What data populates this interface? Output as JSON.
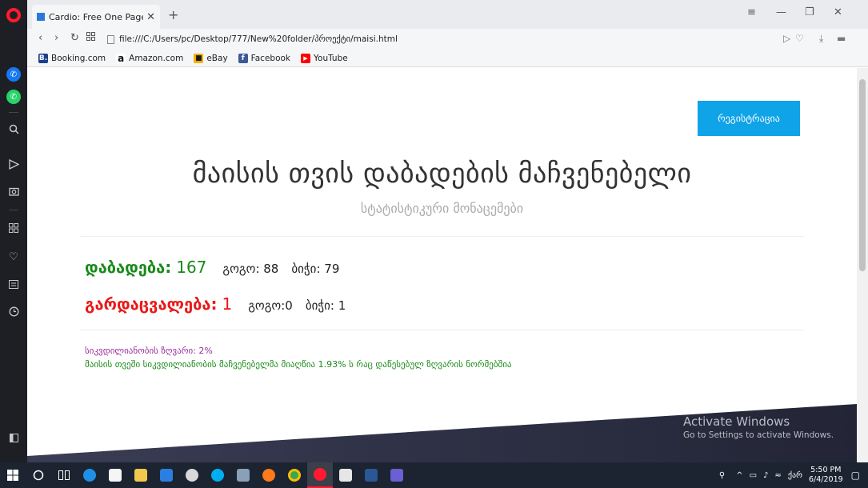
{
  "browser": {
    "tab_title": "Cardio: Free One Page Ten",
    "tab_close": "✕",
    "new_tab": "+",
    "url": "file:///C:/Users/pc/Desktop/777/New%20folder/პროექტი/maisi.html",
    "bookmarks": [
      {
        "label": "Booking.com",
        "icon": "booking-icon",
        "color": "#1b3f8b",
        "glyph": "B."
      },
      {
        "label": "Amazon.com",
        "icon": "amazon-icon",
        "color": "#ffffff",
        "glyph": "a"
      },
      {
        "label": "eBay",
        "icon": "ebay-icon",
        "color": "#e53238",
        "glyph": "🛍"
      },
      {
        "label": "Facebook",
        "icon": "facebook-icon",
        "color": "#3b5998",
        "glyph": "f"
      },
      {
        "label": "YouTube",
        "icon": "youtube-icon",
        "color": "#ff0000",
        "glyph": "▶"
      }
    ]
  },
  "page": {
    "register_button": "რეგისტრაცია",
    "title": "მაისის თვის დაბადების მაჩვენებელი",
    "subtitle": "სტატისტიკური მონაცემები",
    "births": {
      "label": "დაბადება:",
      "value": "167",
      "girls": "გოგო: 88",
      "boys": "ბიჭი: 79"
    },
    "deaths": {
      "label": "გარდაცვალება:",
      "value": "1",
      "girls": "გოგო:0",
      "boys": "ბიჭი: 1"
    },
    "mortality_threshold": "სიკვდილიანობის ზღვარი: 2%",
    "mortality_note": "მაისის თვეში სიკვდილიანობის მაჩვენებელმა მიაღწია 1.93% ს რაც დაწესებულ ზღვარის ნორმებშია"
  },
  "watermark": {
    "line1": "Activate Windows",
    "line2": "Go to Settings to activate Windows."
  },
  "taskbar": {
    "time": "5:50 PM",
    "date": "6/4/2019",
    "lang": "ქარ"
  },
  "colors": {
    "accent": "#0fa3e8",
    "births": "#1a8a1a",
    "deaths": "#e81818",
    "threshold_note": "#9b2e9b"
  }
}
